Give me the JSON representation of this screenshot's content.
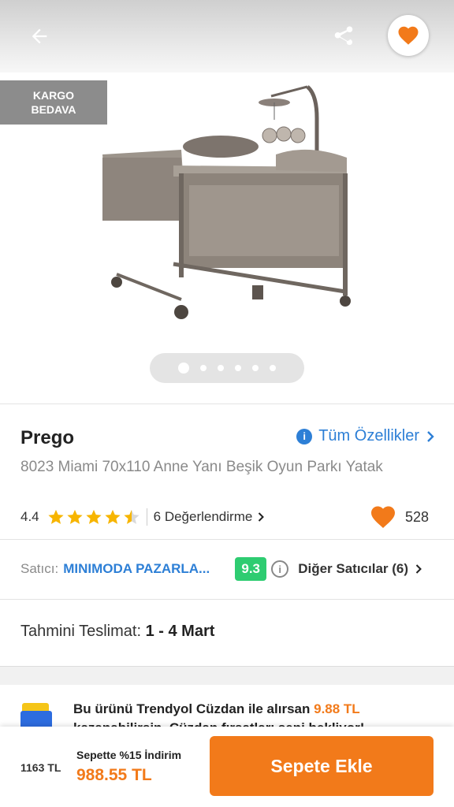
{
  "colors": {
    "accent": "#f27a1a",
    "link": "#2d7fd6",
    "score": "#2ecc71"
  },
  "header": {
    "back_icon": "arrow-left-icon",
    "share_icon": "share-icon",
    "favorite_icon": "heart-icon"
  },
  "gallery": {
    "badge_line1": "KARGO",
    "badge_line2": "BEDAVA",
    "dots_total": 6,
    "active_dot": 1
  },
  "product": {
    "brand": "Prego",
    "all_specs_label": "Tüm Özellikler",
    "title": "8023 Miami 70x110 Anne Yanı Beşik Oyun Parkı Yatak",
    "rating": "4.4",
    "rating_stars": 4.5,
    "reviews_label": "6 Değerlendirme",
    "favorites_count": "528"
  },
  "seller": {
    "label": "Satıcı:",
    "name": "MINIMODA PAZARLA...",
    "score": "9.3",
    "other_sellers_label": "Diğer Satıcılar (6)"
  },
  "delivery": {
    "label": "Tahmini Teslimat:",
    "value": "1 - 4 Mart"
  },
  "wallet": {
    "text": "Bu ürünü Trendyol Cüzdan ile alırsan",
    "amount": "9.88 TL",
    "text2": "kazanabilirsin. Cüzdan fırsatları seni bekliyor!"
  },
  "bottom": {
    "old_price": "1163 TL",
    "discount_label": "Sepette %15 İndirim",
    "new_price": "988.55 TL",
    "add_to_cart": "Sepete Ekle"
  }
}
